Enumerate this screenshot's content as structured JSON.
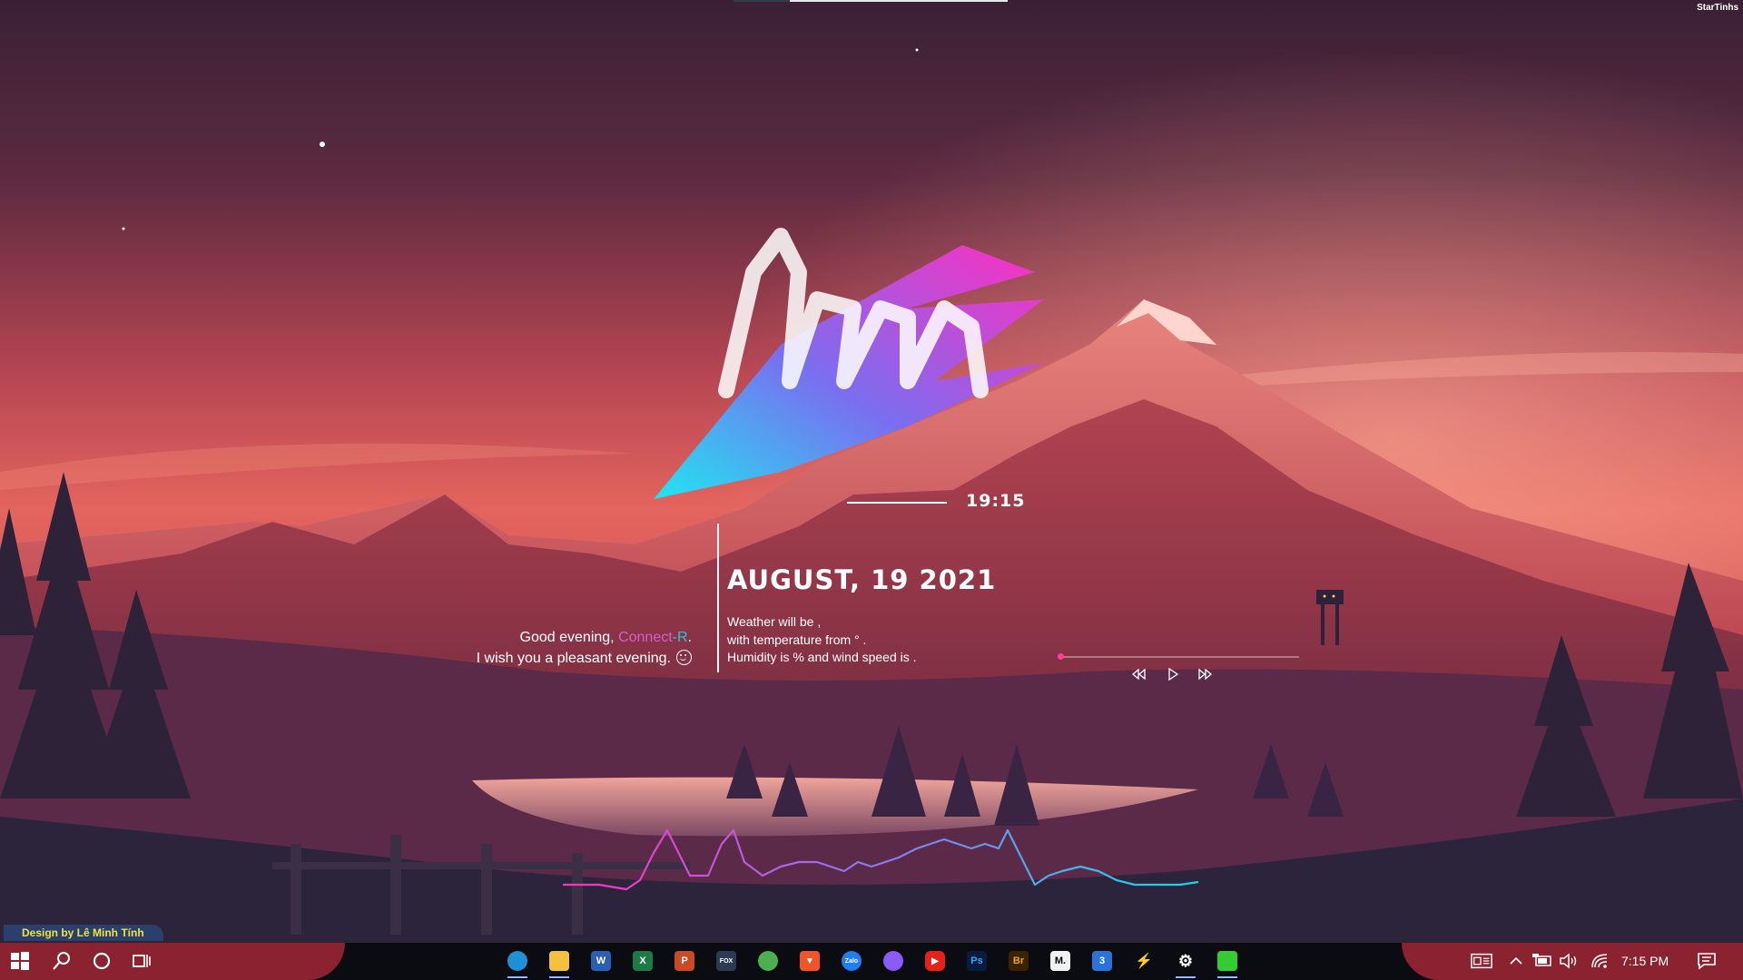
{
  "desktop": {
    "corner_tag": "StarTinhs",
    "clock": "19:15",
    "date": "AUGUST, 19 2021",
    "greeting": {
      "line1_prefix": "Good evening, ",
      "name_part1": "Connect",
      "name_sep": "-",
      "name_part2": "R",
      "line1_suffix": ".",
      "line2": "I wish you a pleasant evening."
    },
    "weather": {
      "line1": "Weather will be ,",
      "line2": "with temperature from ° .",
      "line3": "Humidity is  % and wind speed is  ."
    },
    "media": {
      "progress": 0.0,
      "controls": [
        "rewind-icon",
        "play-icon",
        "fast-forward-icon"
      ]
    },
    "credit": "Design by Lê Minh Tính"
  },
  "taskbar": {
    "pinned_apps": [
      {
        "name": "edge",
        "icon": "edge-icon",
        "label": "",
        "color": "#1e90d6"
      },
      {
        "name": "file-explorer",
        "icon": "folder-icon",
        "label": "",
        "color": "#f3c040"
      },
      {
        "name": "word",
        "icon": "word-icon",
        "label": "W",
        "color": "#2b5fb4"
      },
      {
        "name": "excel",
        "icon": "excel-icon",
        "label": "X",
        "color": "#1d7a45"
      },
      {
        "name": "powerpoint",
        "icon": "powerpoint-icon",
        "label": "P",
        "color": "#c84a26"
      },
      {
        "name": "foxit",
        "icon": "foxit-icon",
        "label": "FOX",
        "color": "#2a3b52"
      },
      {
        "name": "app-green",
        "icon": "green-app-icon",
        "label": "",
        "color": "#4caf50"
      },
      {
        "name": "brave",
        "icon": "brave-icon",
        "label": "",
        "color": "#f0552a"
      },
      {
        "name": "zalo",
        "icon": "zalo-icon",
        "label": "Zalo",
        "color": "#1f7ef0"
      },
      {
        "name": "messenger",
        "icon": "messenger-icon",
        "label": "",
        "color": "#8a5cf5"
      },
      {
        "name": "youtube",
        "icon": "youtube-icon",
        "label": "",
        "color": "#e62117"
      },
      {
        "name": "photoshop",
        "icon": "photoshop-icon",
        "label": "Ps",
        "color": "#0a1b3d"
      },
      {
        "name": "bridge",
        "icon": "bridge-icon",
        "label": "Br",
        "color": "#3a2400"
      },
      {
        "name": "medium",
        "icon": "medium-icon",
        "label": "M.",
        "color": "#f2f2f2"
      },
      {
        "name": "app-3",
        "icon": "number-3-icon",
        "label": "3",
        "color": "#2a74d8"
      },
      {
        "name": "app-lightning",
        "icon": "lightning-icon",
        "label": "",
        "color": "#28d17c"
      },
      {
        "name": "settings",
        "icon": "gear-icon",
        "label": "",
        "color": "#ffffff"
      },
      {
        "name": "app-green-box",
        "icon": "green-box-icon",
        "label": "",
        "color": "#33cc33"
      }
    ],
    "tray_time": "7:15 PM"
  }
}
